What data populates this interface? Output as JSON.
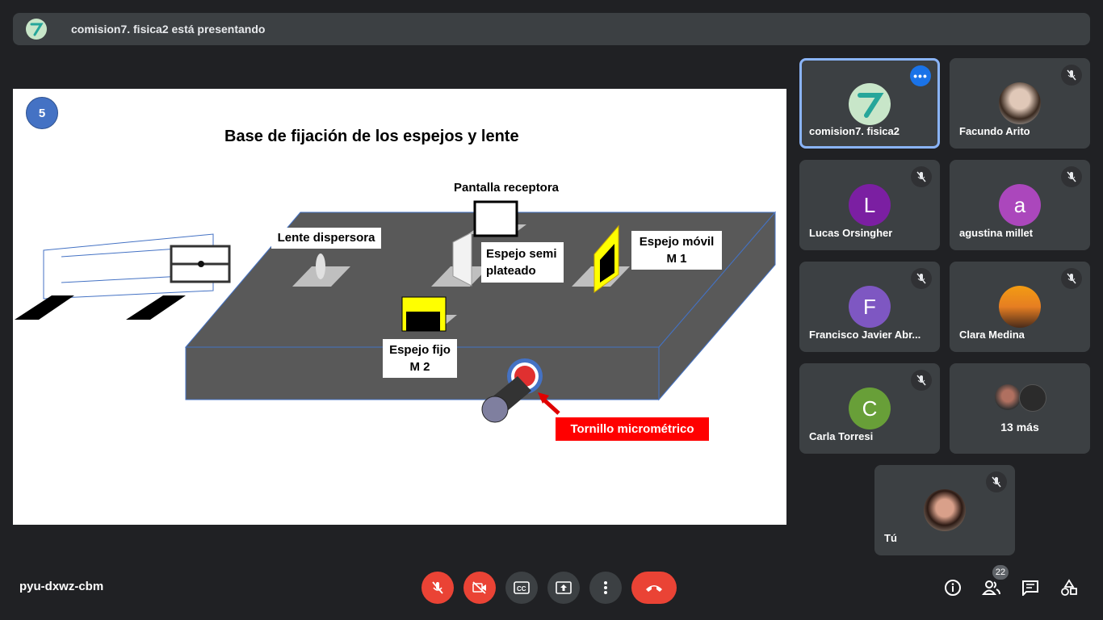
{
  "banner": {
    "presenter_text": "comision7. fisica2 está presentando",
    "avatar_color": "#c8e6c9"
  },
  "slide": {
    "number": "5",
    "title": "Base de fijación de los espejos y lente",
    "labels": {
      "pantalla": "Pantalla receptora",
      "lente": "Lente dispersora",
      "espejo_semi_1": "Espejo semi",
      "espejo_semi_2": "plateado",
      "espejo_movil_1": "Espejo móvil",
      "espejo_movil_2": "M 1",
      "espejo_fijo_1": "Espejo fijo",
      "espejo_fijo_2": "M 2",
      "tornillo": "Tornillo micrométrico"
    }
  },
  "participants": [
    {
      "name": "comision7. fisica2",
      "initial": "",
      "avatar": "logo-7-icon",
      "color": "#c8e6c9",
      "active": true
    },
    {
      "name": "Facundo Arito",
      "initial": "",
      "avatar": "photo",
      "color": "#d9d9d9",
      "muted": true
    },
    {
      "name": "Lucas Orsingher",
      "initial": "L",
      "color": "#7b1fa2",
      "muted": true
    },
    {
      "name": "agustina millet",
      "initial": "a",
      "color": "#ab47bc",
      "muted": true
    },
    {
      "name": "Francisco Javier Abr...",
      "initial": "F",
      "color": "#7e57c2",
      "muted": true
    },
    {
      "name": "Clara Medina",
      "initial": "",
      "avatar": "photo",
      "color": "#e67e22",
      "muted": true
    },
    {
      "name": "Carla Torresi",
      "initial": "C",
      "color": "#689f38",
      "muted": true
    },
    {
      "name": "13 más",
      "initial": "",
      "avatar": "group"
    },
    {
      "name": "Tú",
      "initial": "",
      "avatar": "photo",
      "color": "#d7ccc8",
      "muted": true
    }
  ],
  "footer": {
    "meeting_code": "pyu-dxwz-cbm",
    "participant_count": "22"
  },
  "colors": {
    "background": "#202124",
    "tile": "#3c4043",
    "end_call": "#ea4335",
    "accent": "#8ab4f8"
  }
}
